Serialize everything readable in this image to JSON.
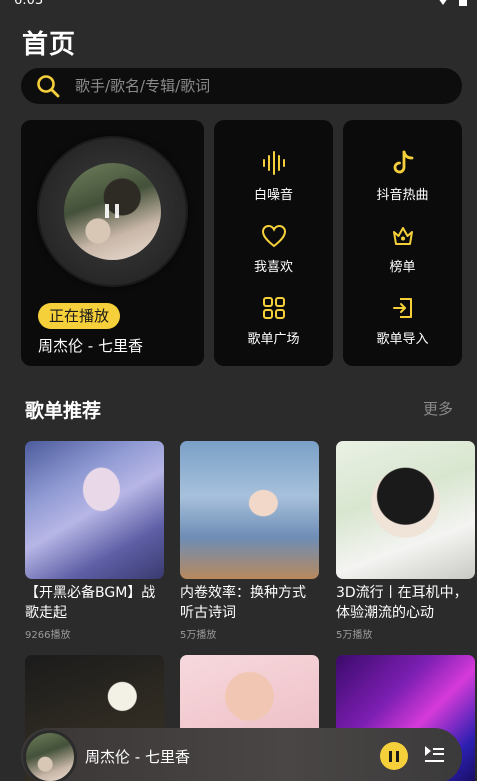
{
  "status": {
    "time": "6:03"
  },
  "header": {
    "title": "首页"
  },
  "search": {
    "placeholder": "歌手/歌名/专辑/歌词"
  },
  "now_playing": {
    "badge": "正在播放",
    "song": "周杰伦 - 七里香"
  },
  "quick_links": [
    {
      "label": "白噪音",
      "icon": "waveform-icon"
    },
    {
      "label": "我喜欢",
      "icon": "heart-icon"
    },
    {
      "label": "歌单广场",
      "icon": "grid-icon"
    },
    {
      "label": "抖音热曲",
      "icon": "tiktok-icon"
    },
    {
      "label": "榜单",
      "icon": "crown-icon"
    },
    {
      "label": "歌单导入",
      "icon": "import-icon"
    }
  ],
  "recommend": {
    "title": "歌单推荐",
    "more": "更多",
    "playlists": [
      {
        "title": "【开黑必备BGM】战歌走起",
        "plays": "9266播放"
      },
      {
        "title": "内卷效率：换种方式听古诗词",
        "plays": "5万播放"
      },
      {
        "title": "3D流行丨在耳机中，体验潮流的心动",
        "plays": "5万播放"
      },
      {
        "title": "",
        "plays": ""
      },
      {
        "title": "",
        "plays": ""
      },
      {
        "title": "",
        "plays": ""
      }
    ]
  },
  "mini_player": {
    "song": "周杰伦 - 七里香"
  },
  "colors": {
    "accent": "#f5d03b",
    "card_bg": "#0b0b0b",
    "page_bg": "#2b2b2b"
  }
}
